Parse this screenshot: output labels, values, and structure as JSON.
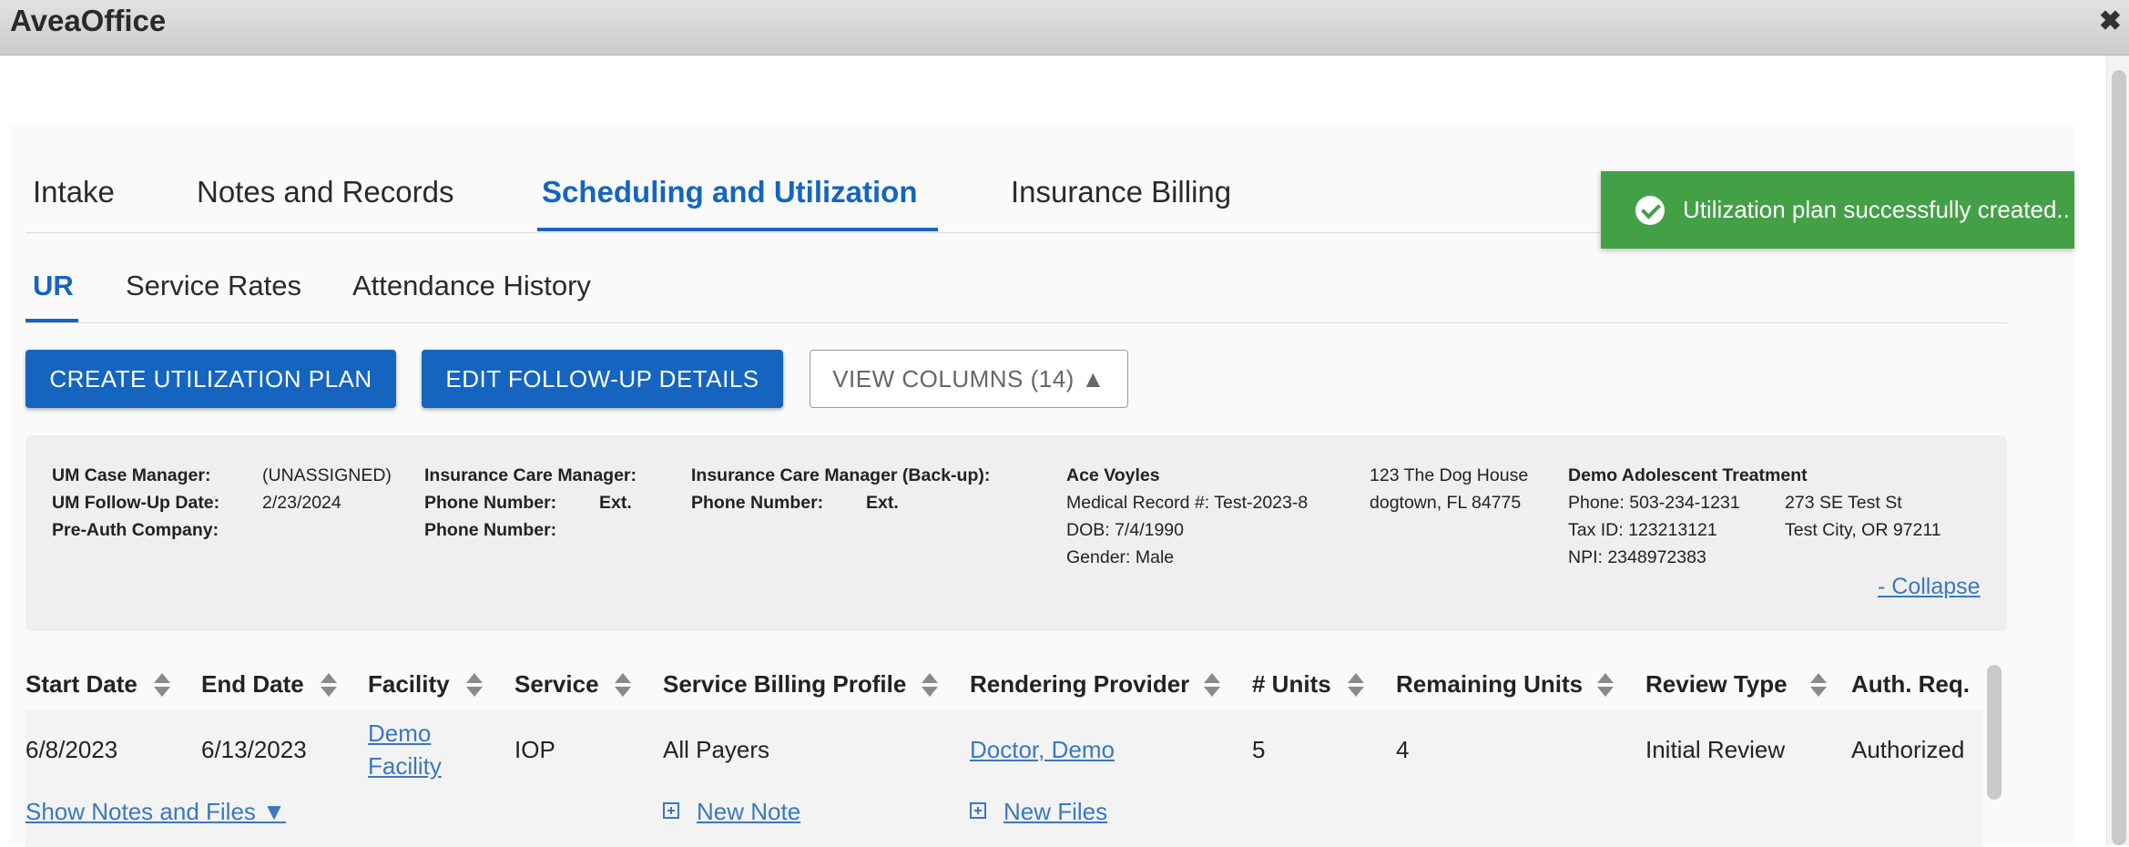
{
  "app": {
    "title": "AveaOffice",
    "close_label": "✖"
  },
  "tabs": [
    "Intake",
    "Notes and Records",
    "Scheduling and Utilization",
    "Insurance Billing"
  ],
  "active_tab": "Scheduling and Utilization",
  "subtabs": [
    "UR",
    "Service Rates",
    "Attendance History"
  ],
  "active_subtab": "UR",
  "buttons": {
    "create": "CREATE UTILIZATION PLAN",
    "edit_followup": "EDIT FOLLOW-UP DETAILS",
    "view_columns": "VIEW COLUMNS (14) ▲"
  },
  "info": {
    "um_case_manager_label": "UM Case Manager:",
    "um_case_manager_value": "(UNASSIGNED)",
    "um_followup_label": "UM Follow-Up Date:",
    "um_followup_value": "2/23/2024",
    "preauth_label": "Pre-Auth Company:",
    "ins_cm_label": "Insurance Care Manager:",
    "phone_label": "Phone Number:",
    "ext_label": "Ext.",
    "ins_cm_backup_label": "Insurance Care Manager (Back-up):",
    "patient": {
      "name": "Ace Voyles",
      "mrn": "Medical Record #: Test-2023-8",
      "dob": "DOB: 7/4/1990",
      "gender": "Gender: Male",
      "address1": "123 The Dog House",
      "address2": "dogtown, FL 84775"
    },
    "facility": {
      "name": "Demo Adolescent Treatment",
      "phone": "Phone: 503-234-1231",
      "tax_id": "Tax ID: 123213121",
      "npi": "NPI: 2348972383",
      "address1": "273 SE Test St",
      "address2": "Test City, OR 97211"
    },
    "collapse": "- Collapse"
  },
  "table": {
    "headers": [
      "Start Date",
      "End Date",
      "Facility",
      "Service",
      "Service Billing Profile",
      "Rendering Provider",
      "# Units",
      "Remaining Units",
      "Review Type",
      "Auth. Req."
    ],
    "row": {
      "start_date": "6/8/2023",
      "end_date": "6/13/2023",
      "facility_line1": "Demo",
      "facility_line2": "Facility",
      "service": "IOP",
      "billing_profile": "All Payers",
      "provider": "Doctor, Demo",
      "units": "5",
      "remaining_units": "4",
      "review_type": "Initial Review",
      "auth_req": "Authorized"
    },
    "show_notes": "Show Notes and Files ▼",
    "new_note": "New Note",
    "new_files": "New Files"
  },
  "toast": {
    "message": "Utilization plan successfully created.."
  },
  "colors": {
    "accent": "#1565c0",
    "success": "#43a047",
    "link": "#3a78c0"
  }
}
